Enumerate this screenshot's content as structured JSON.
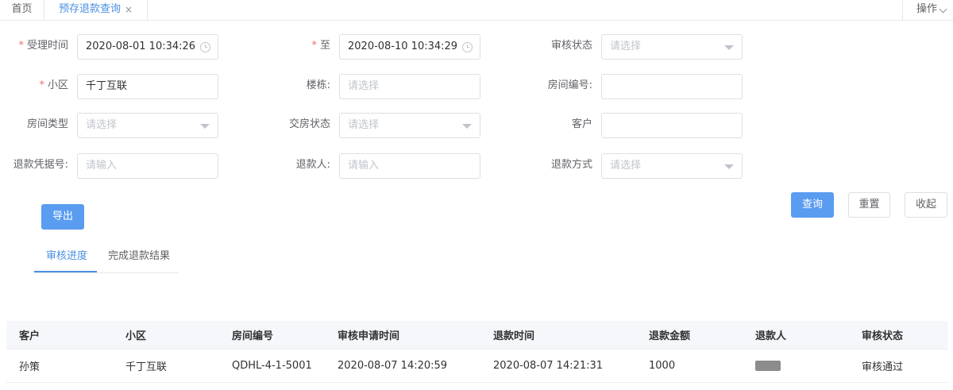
{
  "tabs": {
    "home": "首页",
    "active": "预存退款查询",
    "close": "×",
    "ops": "操作"
  },
  "form": {
    "accept_time_label": "受理时间",
    "accept_time_value": "2020-08-01 10:34:26",
    "to_label": "至",
    "to_value": "2020-08-10 10:34:29",
    "audit_status_label": "审核状态",
    "audit_status_placeholder": "请选择",
    "community_label": "小区",
    "community_value": "千丁互联",
    "building_label": "楼栋:",
    "building_placeholder": "请选择",
    "room_no_label": "房间编号:",
    "room_no_value": "",
    "room_type_label": "房间类型",
    "room_type_placeholder": "请选择",
    "handover_label": "交房状态",
    "handover_placeholder": "请选择",
    "customer_label": "客户",
    "customer_value": "",
    "voucher_label": "退款凭据号:",
    "voucher_placeholder": "请输入",
    "refunder_label": "退款人:",
    "refunder_placeholder": "请输入",
    "refund_method_label": "退款方式",
    "refund_method_placeholder": "请选择",
    "required_mark": "*"
  },
  "buttons": {
    "query": "查询",
    "reset": "重置",
    "collapse": "收起",
    "export": "导出"
  },
  "subtabs": [
    "审核进度",
    "完成退款结果"
  ],
  "table": {
    "headers": [
      "客户",
      "小区",
      "房间编号",
      "审核申请时间",
      "退款时间",
      "退款金额",
      "退款人",
      "审核状态"
    ],
    "rows": [
      [
        "孙策",
        "千丁互联",
        "QDHL-4-1-5001",
        "2020-08-07 14:20:59",
        "2020-08-07 14:21:31",
        "1000",
        "",
        "审核通过"
      ]
    ]
  }
}
